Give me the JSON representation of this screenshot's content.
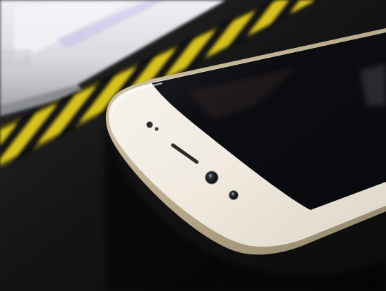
{
  "photo": {
    "subject": "smartphone",
    "background_color": "#141414",
    "stripe_yellow": "#d7c21c",
    "stripe_black": "#171717",
    "phone_frame_color": "#efe9de",
    "phone_glass_color": "#07090c",
    "phone_gold_edge": "#b8aa8a",
    "monitor_color": "#d9dbe1"
  }
}
